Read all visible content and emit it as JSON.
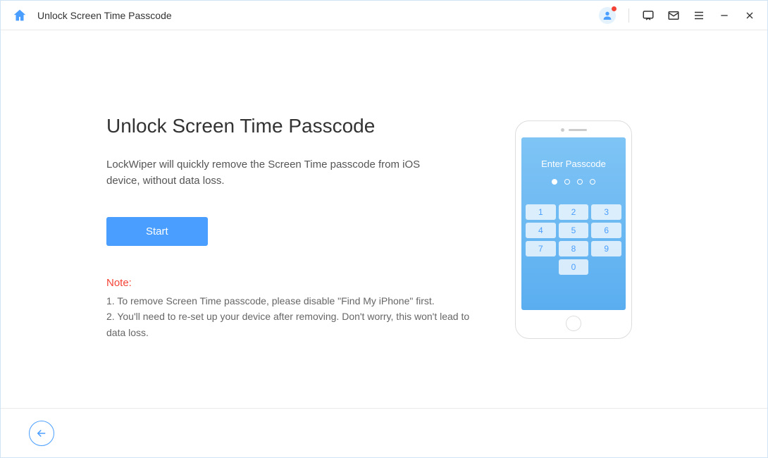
{
  "titlebar": {
    "title": "Unlock Screen Time Passcode"
  },
  "main": {
    "heading": "Unlock Screen Time Passcode",
    "description": "LockWiper will quickly remove the Screen Time passcode from iOS device, without data loss.",
    "start_label": "Start",
    "note_label": "Note:",
    "note_line1": "1. To remove Screen Time passcode, please disable \"Find My iPhone\" first.",
    "note_line2": "2. You'll need to re-set up your device after removing. Don't worry, this won't lead to data loss."
  },
  "phone": {
    "passcode_label": "Enter Passcode",
    "keys": [
      "1",
      "2",
      "3",
      "4",
      "5",
      "6",
      "7",
      "8",
      "9",
      "0"
    ]
  }
}
